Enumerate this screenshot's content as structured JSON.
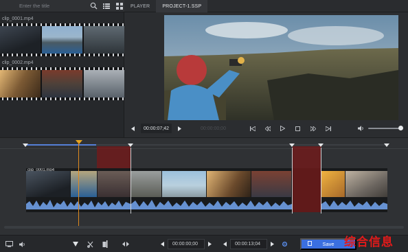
{
  "search": {
    "placeholder": "Enter the title"
  },
  "library": {
    "clips": [
      {
        "label": "clip_0001.mp4"
      },
      {
        "label": "clip_0002.mp4"
      }
    ]
  },
  "tabs": [
    {
      "label": "PLAYER",
      "active": false
    },
    {
      "label": "PROJECT-1.SSP",
      "active": true
    }
  ],
  "player": {
    "current_timecode": "00:00:07;42",
    "ghost_timecode": "00:00:00;00",
    "volume": 0.95
  },
  "timeline": {
    "clip_name": "clip_0001.mp4"
  },
  "bottombar": {
    "in_timecode": "00:00:00;00",
    "out_timecode": "00:00:13;04",
    "save_label": "Save"
  },
  "watermark": "综合信息",
  "colors": {
    "accent": "#3a6fe0",
    "playhead": "#e7a51f",
    "waveform": "#6f9ee6",
    "red_region": "#7a1818"
  }
}
